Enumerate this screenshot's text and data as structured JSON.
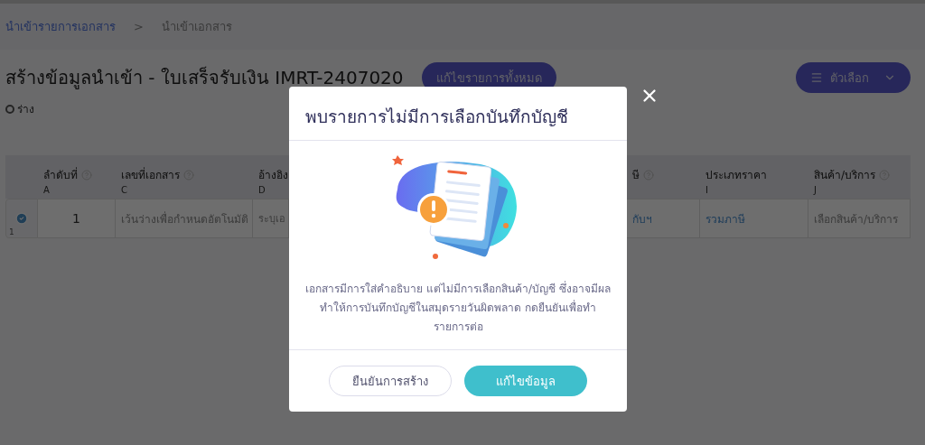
{
  "breadcrumb": {
    "items": [
      {
        "label": "นำเข้ารายการเอกสาร",
        "kind": "link"
      },
      {
        "label": "นำเข้าเอกสาร",
        "kind": "current"
      }
    ],
    "separator": ">"
  },
  "title": "สร้างข้อมูลนำเข้า - ใบเสร็จรับเงิน IMRT-2407020",
  "edit_all_button": "แก้ไขรายการทั้งหมด",
  "options_button": "ตัวเลือก",
  "status": "ร่าง",
  "table": {
    "columns": [
      {
        "label": "ลำดับที่",
        "letter": "A",
        "help": true
      },
      {
        "label": "เลขที่เอกสาร",
        "letter": "C",
        "help": true
      },
      {
        "label": "อ้างอิง",
        "letter": "D"
      },
      {
        "label": "ษี",
        "help": true
      },
      {
        "label": "ประเภทราคา",
        "letter": "I",
        "help": false
      },
      {
        "label": "สินค้า/บริการ",
        "letter": "J",
        "help": true
      }
    ],
    "rows": [
      {
        "selected": true,
        "row_number": "1",
        "cells": [
          {
            "text": "1",
            "kind": "value"
          },
          {
            "text": "เว้นว่างเพื่อกำหนดอัตโนมัติ",
            "kind": "placeholder"
          },
          {
            "text": "ระบุเอ",
            "kind": "placeholder"
          },
          {
            "text": "กับฯ",
            "kind": "link"
          },
          {
            "text": "รวมภาษี",
            "kind": "link"
          },
          {
            "text": "เลือกสินค้า/บริการ",
            "kind": "placeholder"
          }
        ]
      }
    ]
  },
  "modal": {
    "title": "พบรายการไม่มีการเลือกบันทึกบัญชี",
    "message": "เอกสารมีการใส่คำอธิบาย แต่ไม่มีการเลือกสินค้า/บัญชี ซึ่งอาจมีผลทำให้การบันทึกบัญชีในสมุดรายวันผิดพลาด กดยืนยันเพื่อทำรายการต่อ",
    "buttons": [
      {
        "label": "ยืนยันการสร้าง",
        "kind": "secondary"
      },
      {
        "label": "แก้ไขข้อมูล",
        "kind": "primary"
      }
    ]
  }
}
